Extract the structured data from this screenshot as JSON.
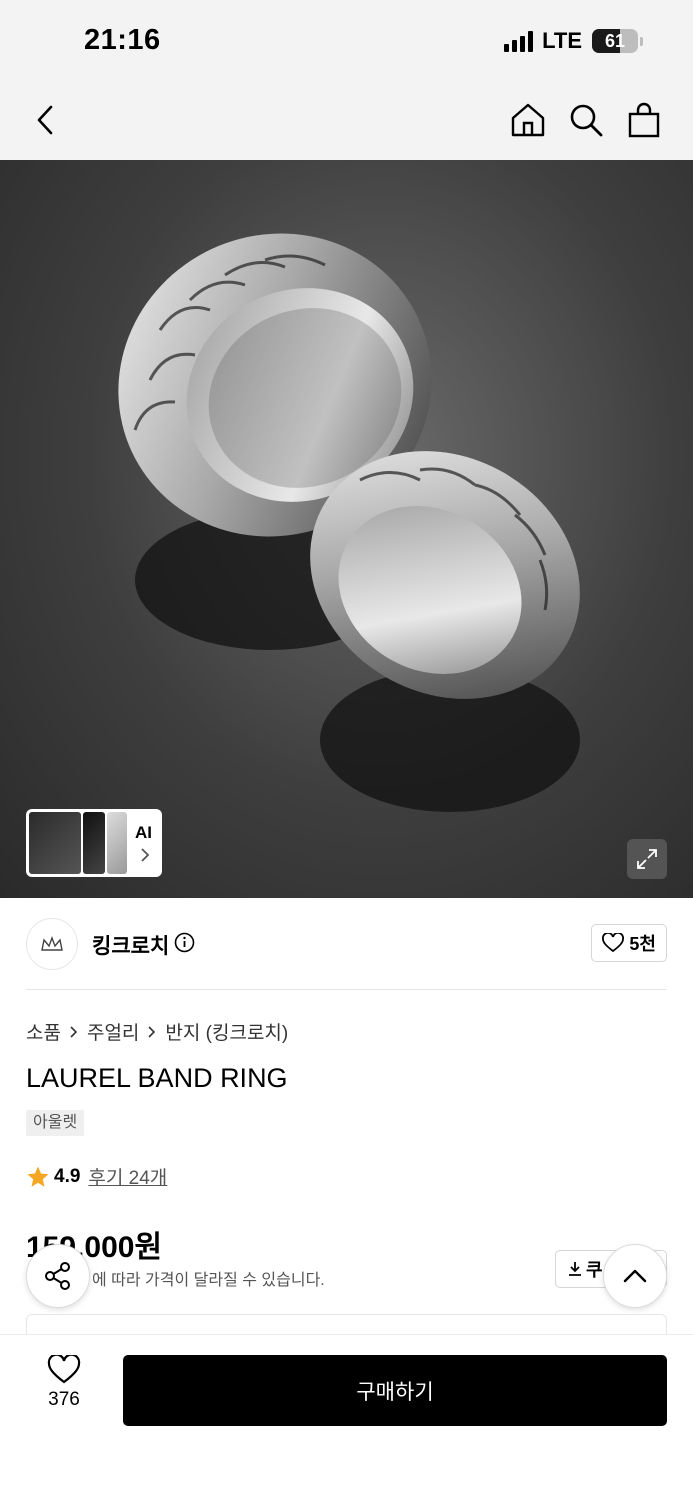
{
  "status_bar": {
    "time": "21:16",
    "network": "LTE",
    "battery": "61",
    "battery_level": 0.61
  },
  "nav": {
    "back_icon": "chevron-left-icon",
    "home_icon": "home-icon",
    "search_icon": "search-icon",
    "cart_icon": "shopping-bag-icon"
  },
  "hero": {
    "thumb_ai_label": "AI",
    "expand_icon": "expand-icon"
  },
  "brand": {
    "name": "킹크로치",
    "likes": "5천",
    "info_icon": "info-icon"
  },
  "breadcrumb": [
    "소품",
    "주얼리",
    "반지 (킹크로치)"
  ],
  "product": {
    "title": "LAUREL BAND RING",
    "tag": "아울렛",
    "rating": "4.9",
    "review_label": "후기 24개",
    "price": "159,000원",
    "price_note": "에 따라 가격이 달라질 수 있습니다.",
    "coupon_label": "쿠"
  },
  "bottom_bar": {
    "wish_count": "376",
    "buy_label": "구매하기"
  },
  "colors": {
    "accent_star": "#f5a623",
    "buy_button": "#000000"
  }
}
